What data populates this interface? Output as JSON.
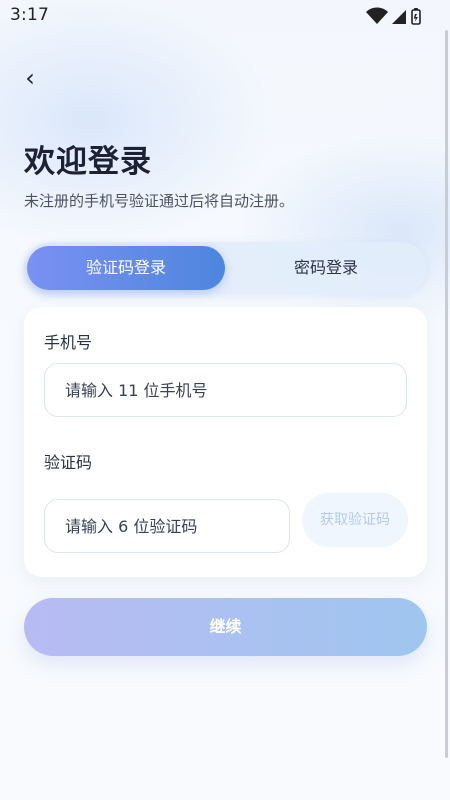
{
  "status_bar": {
    "time": "3:17"
  },
  "header": {
    "back_glyph": "‹",
    "title": "欢迎登录",
    "subtitle": "未注册的手机号验证通过后将自动注册。"
  },
  "tabs": [
    {
      "label": "验证码登录",
      "active": true
    },
    {
      "label": "密码登录",
      "active": false
    }
  ],
  "form": {
    "phone_label": "手机号",
    "phone_placeholder": "请输入 11 位手机号",
    "code_label": "验证码",
    "code_placeholder": "请输入 6 位验证码",
    "get_code_label": "获取验证码"
  },
  "actions": {
    "continue_label": "继续"
  },
  "theme": {
    "accent_start": "#7b90f4",
    "accent_end": "#4d86dd",
    "button_disabled_start": "#b8bbf3",
    "button_disabled_end": "#9fc6ef"
  }
}
